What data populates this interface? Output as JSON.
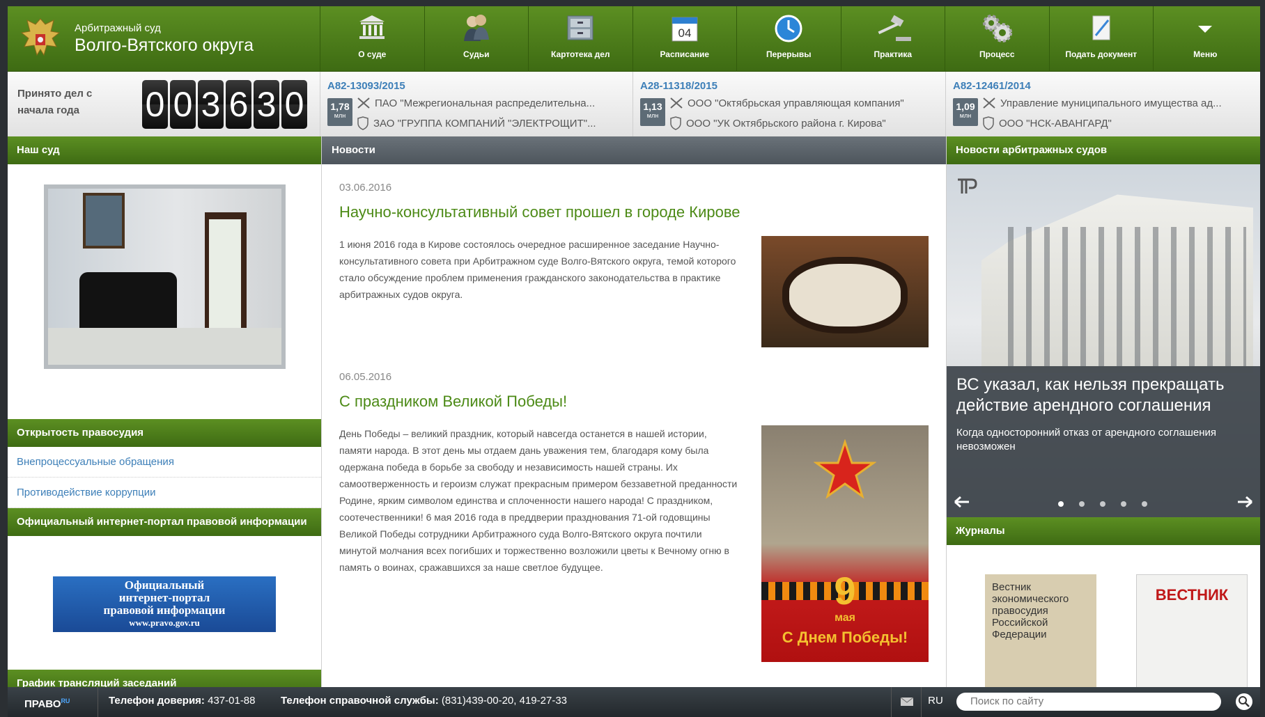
{
  "header": {
    "title_small": "Арбитражный суд",
    "title_big": "Волго-Вятского округа",
    "nav": [
      {
        "label": "О суде",
        "icon": "building-icon"
      },
      {
        "label": "Судьи",
        "icon": "judges-icon"
      },
      {
        "label": "Картотека дел",
        "icon": "file-cabinet-icon"
      },
      {
        "label": "Расписание",
        "icon": "calendar-icon",
        "calendar_day": "04"
      },
      {
        "label": "Перерывы",
        "icon": "clock-icon"
      },
      {
        "label": "Практика",
        "icon": "gavel-icon"
      },
      {
        "label": "Процесс",
        "icon": "gears-icon"
      },
      {
        "label": "Подать документ",
        "icon": "document-icon"
      },
      {
        "label": "Меню",
        "icon": "chevron-down-icon"
      }
    ]
  },
  "counter": {
    "label": "Принято дел с начала года",
    "digits": [
      "0",
      "0",
      "3",
      "6",
      "3",
      "0"
    ]
  },
  "cases": [
    {
      "number": "А82-13093/2015",
      "sum": "1,78",
      "unit": "млн",
      "plaintiff": "ПАО \"Межрегиональная распределительна...",
      "defendant": "ЗАО \"ГРУППА КОМПАНИЙ \"ЭЛЕКТРОЩИТ\"..."
    },
    {
      "number": "А28-11318/2015",
      "sum": "1,13",
      "unit": "млн",
      "plaintiff": "ООО \"Октябрьская управляющая компания\"",
      "defendant": "ООО \"УК Октябрьского района г. Кирова\""
    },
    {
      "number": "А82-12461/2014",
      "sum": "1,09",
      "unit": "млн",
      "plaintiff": "Управление муниципального имущества ад...",
      "defendant": "ООО \"НСК-АВАНГАРД\""
    }
  ],
  "left": {
    "our_court": "Наш суд",
    "openness_title": "Открытость правосудия",
    "links": [
      "Внепроцессуальные обращения",
      "Противодействие коррупции"
    ],
    "portal_title": "Официальный интернет-портал правовой информации",
    "banner_lines": [
      "Официальный",
      "интернет-портал",
      "правовой информации",
      "www.pravo.gov.ru"
    ],
    "broadcast_title": "График трансляций заседаний"
  },
  "news": {
    "section_title": "Новости",
    "items": [
      {
        "date": "03.06.2016",
        "title": "Научно-консультативный совет прошел в городе Кирове",
        "body": "1 июня 2016 года в Кирове состоялось очередное расширенное заседание Научно-консультативного совета при Арбитражном суде Волго-Вятского округа, темой которого стало обсуждение проблем применения гражданского законодательства в практике арбитражных судов округа."
      },
      {
        "date": "06.05.2016",
        "title": "С праздником Великой Победы!",
        "body": "День Победы – великий праздник, который навсегда останется в нашей истории, памяти народа. В этот день мы отдаем дань уважения тем, благодаря кому была одержана победа в борьбе за свободу и независимость нашей страны. Их самоотверженность и героизм служат прекрасным примером беззаветной преданности Родине, ярким символом единства и сплоченности нашего народа! С праздником, соотечественники! 6 мая 2016 года в преддверии празднования 71-ой годовщины Великой Победы сотрудники Арбитражного суда Волго-Вятского округа почтили минутой молчания всех погибших и торжественно возложили цветы к Вечному огню в память о воинах, сражавшихся за наше светлое будущее.",
        "poster_day": "9",
        "poster_month": "мая",
        "poster_text": "С Днем Победы!"
      }
    ]
  },
  "right": {
    "arb_news_title": "Новости арбитражных судов",
    "slide_title": "ВС указал, как нельзя прекращать действие арендного соглашения",
    "slide_sub": "Когда односторонний отказ от арендного соглашения невозможен",
    "dots": 5,
    "active_dot": 1,
    "journals_title": "Журналы",
    "journal1": "Вестник экономического правосудия Российской Федерации",
    "journal2": "ВЕСТНИК"
  },
  "footer": {
    "brand": "ПРАВО",
    "brand_suffix": "RU",
    "trust_label": "Телефон доверия:",
    "trust_phone": "437-01-88",
    "help_label": "Телефон справочной службы:",
    "help_phone": "(831)439-00-20, 419-27-33",
    "lang": "RU",
    "search_placeholder": "Поиск по сайту"
  },
  "colors": {
    "green": "#4c8a16",
    "link": "#3d7fb8",
    "dark_bar": "#4d555c"
  }
}
